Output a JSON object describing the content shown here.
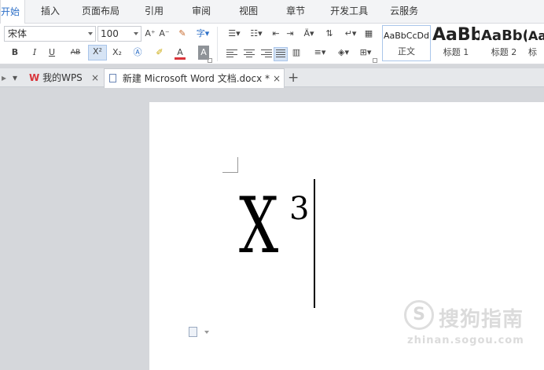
{
  "menu_tabs": [
    "开始",
    "插入",
    "页面布局",
    "引用",
    "审阅",
    "视图",
    "章节",
    "开发工具",
    "云服务"
  ],
  "font": {
    "name": "宋体",
    "size": "100"
  },
  "toolbar": {
    "grow_font": "A⁺",
    "shrink_font": "A⁻",
    "bold": "B",
    "italic": "I",
    "underline": "U",
    "strikethrough": "AB",
    "superscript": "X²",
    "subscript": "X₂",
    "font_color": "A",
    "char_shading": "A"
  },
  "styles": [
    {
      "sample": "AaBbCcDd",
      "name": "正文"
    },
    {
      "sample": "AaBb",
      "name": "标题 1"
    },
    {
      "sample": "AaBb(",
      "name": "标题 2"
    },
    {
      "sample": "Aa",
      "name": "标"
    }
  ],
  "doc_tabs": {
    "home": "我的WPS",
    "document": "新建 Microsoft Word 文档.docx *",
    "close_glyph": "×",
    "new_tab_glyph": "+"
  },
  "document": {
    "base": "X",
    "superscript": "3"
  },
  "watermark": {
    "brand": "搜狗指南",
    "url": "zhinan.sogou.com"
  },
  "colors": {
    "accent": "#2d6fc7",
    "wps_red": "#d9343a",
    "workspace": "#d5d7db"
  }
}
